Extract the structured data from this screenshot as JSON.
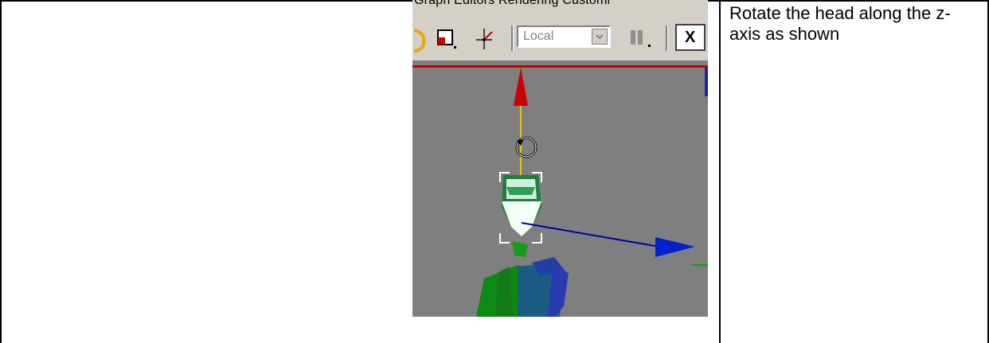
{
  "instruction": {
    "text": "Rotate the head along the z-axis as shown"
  },
  "screenshot": {
    "menu_text": "Graph Editors   Rendering   Customi",
    "coordinate_system": "Local",
    "axis_constraint_label": "X"
  },
  "colors": {
    "viewport_bg": "#7f7f7f",
    "toolbar_bg": "#d4d0c8",
    "z_axis": "#cc0000",
    "x_axis": "#0000cc",
    "y_axis": "#00aa00",
    "rotate_line": "#e6c800"
  }
}
